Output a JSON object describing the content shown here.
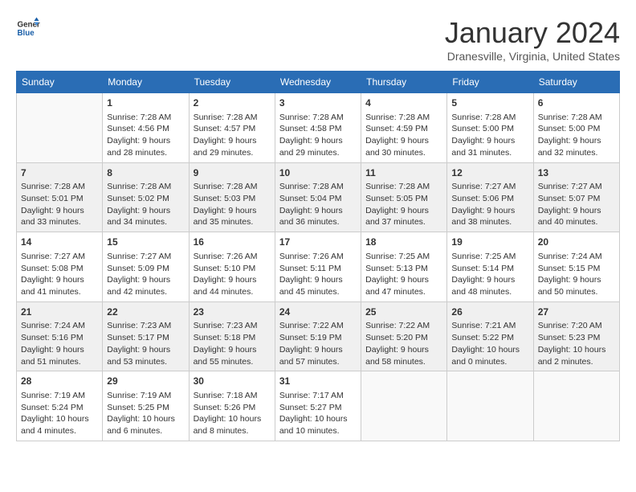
{
  "header": {
    "logo_line1": "General",
    "logo_line2": "Blue",
    "month": "January 2024",
    "location": "Dranesville, Virginia, United States"
  },
  "weekdays": [
    "Sunday",
    "Monday",
    "Tuesday",
    "Wednesday",
    "Thursday",
    "Friday",
    "Saturday"
  ],
  "weeks": [
    [
      {
        "day": "",
        "sunrise": "",
        "sunset": "",
        "daylight": ""
      },
      {
        "day": "1",
        "sunrise": "Sunrise: 7:28 AM",
        "sunset": "Sunset: 4:56 PM",
        "daylight": "Daylight: 9 hours and 28 minutes."
      },
      {
        "day": "2",
        "sunrise": "Sunrise: 7:28 AM",
        "sunset": "Sunset: 4:57 PM",
        "daylight": "Daylight: 9 hours and 29 minutes."
      },
      {
        "day": "3",
        "sunrise": "Sunrise: 7:28 AM",
        "sunset": "Sunset: 4:58 PM",
        "daylight": "Daylight: 9 hours and 29 minutes."
      },
      {
        "day": "4",
        "sunrise": "Sunrise: 7:28 AM",
        "sunset": "Sunset: 4:59 PM",
        "daylight": "Daylight: 9 hours and 30 minutes."
      },
      {
        "day": "5",
        "sunrise": "Sunrise: 7:28 AM",
        "sunset": "Sunset: 5:00 PM",
        "daylight": "Daylight: 9 hours and 31 minutes."
      },
      {
        "day": "6",
        "sunrise": "Sunrise: 7:28 AM",
        "sunset": "Sunset: 5:00 PM",
        "daylight": "Daylight: 9 hours and 32 minutes."
      }
    ],
    [
      {
        "day": "7",
        "sunrise": "Sunrise: 7:28 AM",
        "sunset": "Sunset: 5:01 PM",
        "daylight": "Daylight: 9 hours and 33 minutes."
      },
      {
        "day": "8",
        "sunrise": "Sunrise: 7:28 AM",
        "sunset": "Sunset: 5:02 PM",
        "daylight": "Daylight: 9 hours and 34 minutes."
      },
      {
        "day": "9",
        "sunrise": "Sunrise: 7:28 AM",
        "sunset": "Sunset: 5:03 PM",
        "daylight": "Daylight: 9 hours and 35 minutes."
      },
      {
        "day": "10",
        "sunrise": "Sunrise: 7:28 AM",
        "sunset": "Sunset: 5:04 PM",
        "daylight": "Daylight: 9 hours and 36 minutes."
      },
      {
        "day": "11",
        "sunrise": "Sunrise: 7:28 AM",
        "sunset": "Sunset: 5:05 PM",
        "daylight": "Daylight: 9 hours and 37 minutes."
      },
      {
        "day": "12",
        "sunrise": "Sunrise: 7:27 AM",
        "sunset": "Sunset: 5:06 PM",
        "daylight": "Daylight: 9 hours and 38 minutes."
      },
      {
        "day": "13",
        "sunrise": "Sunrise: 7:27 AM",
        "sunset": "Sunset: 5:07 PM",
        "daylight": "Daylight: 9 hours and 40 minutes."
      }
    ],
    [
      {
        "day": "14",
        "sunrise": "Sunrise: 7:27 AM",
        "sunset": "Sunset: 5:08 PM",
        "daylight": "Daylight: 9 hours and 41 minutes."
      },
      {
        "day": "15",
        "sunrise": "Sunrise: 7:27 AM",
        "sunset": "Sunset: 5:09 PM",
        "daylight": "Daylight: 9 hours and 42 minutes."
      },
      {
        "day": "16",
        "sunrise": "Sunrise: 7:26 AM",
        "sunset": "Sunset: 5:10 PM",
        "daylight": "Daylight: 9 hours and 44 minutes."
      },
      {
        "day": "17",
        "sunrise": "Sunrise: 7:26 AM",
        "sunset": "Sunset: 5:11 PM",
        "daylight": "Daylight: 9 hours and 45 minutes."
      },
      {
        "day": "18",
        "sunrise": "Sunrise: 7:25 AM",
        "sunset": "Sunset: 5:13 PM",
        "daylight": "Daylight: 9 hours and 47 minutes."
      },
      {
        "day": "19",
        "sunrise": "Sunrise: 7:25 AM",
        "sunset": "Sunset: 5:14 PM",
        "daylight": "Daylight: 9 hours and 48 minutes."
      },
      {
        "day": "20",
        "sunrise": "Sunrise: 7:24 AM",
        "sunset": "Sunset: 5:15 PM",
        "daylight": "Daylight: 9 hours and 50 minutes."
      }
    ],
    [
      {
        "day": "21",
        "sunrise": "Sunrise: 7:24 AM",
        "sunset": "Sunset: 5:16 PM",
        "daylight": "Daylight: 9 hours and 51 minutes."
      },
      {
        "day": "22",
        "sunrise": "Sunrise: 7:23 AM",
        "sunset": "Sunset: 5:17 PM",
        "daylight": "Daylight: 9 hours and 53 minutes."
      },
      {
        "day": "23",
        "sunrise": "Sunrise: 7:23 AM",
        "sunset": "Sunset: 5:18 PM",
        "daylight": "Daylight: 9 hours and 55 minutes."
      },
      {
        "day": "24",
        "sunrise": "Sunrise: 7:22 AM",
        "sunset": "Sunset: 5:19 PM",
        "daylight": "Daylight: 9 hours and 57 minutes."
      },
      {
        "day": "25",
        "sunrise": "Sunrise: 7:22 AM",
        "sunset": "Sunset: 5:20 PM",
        "daylight": "Daylight: 9 hours and 58 minutes."
      },
      {
        "day": "26",
        "sunrise": "Sunrise: 7:21 AM",
        "sunset": "Sunset: 5:22 PM",
        "daylight": "Daylight: 10 hours and 0 minutes."
      },
      {
        "day": "27",
        "sunrise": "Sunrise: 7:20 AM",
        "sunset": "Sunset: 5:23 PM",
        "daylight": "Daylight: 10 hours and 2 minutes."
      }
    ],
    [
      {
        "day": "28",
        "sunrise": "Sunrise: 7:19 AM",
        "sunset": "Sunset: 5:24 PM",
        "daylight": "Daylight: 10 hours and 4 minutes."
      },
      {
        "day": "29",
        "sunrise": "Sunrise: 7:19 AM",
        "sunset": "Sunset: 5:25 PM",
        "daylight": "Daylight: 10 hours and 6 minutes."
      },
      {
        "day": "30",
        "sunrise": "Sunrise: 7:18 AM",
        "sunset": "Sunset: 5:26 PM",
        "daylight": "Daylight: 10 hours and 8 minutes."
      },
      {
        "day": "31",
        "sunrise": "Sunrise: 7:17 AM",
        "sunset": "Sunset: 5:27 PM",
        "daylight": "Daylight: 10 hours and 10 minutes."
      },
      {
        "day": "",
        "sunrise": "",
        "sunset": "",
        "daylight": ""
      },
      {
        "day": "",
        "sunrise": "",
        "sunset": "",
        "daylight": ""
      },
      {
        "day": "",
        "sunrise": "",
        "sunset": "",
        "daylight": ""
      }
    ]
  ]
}
